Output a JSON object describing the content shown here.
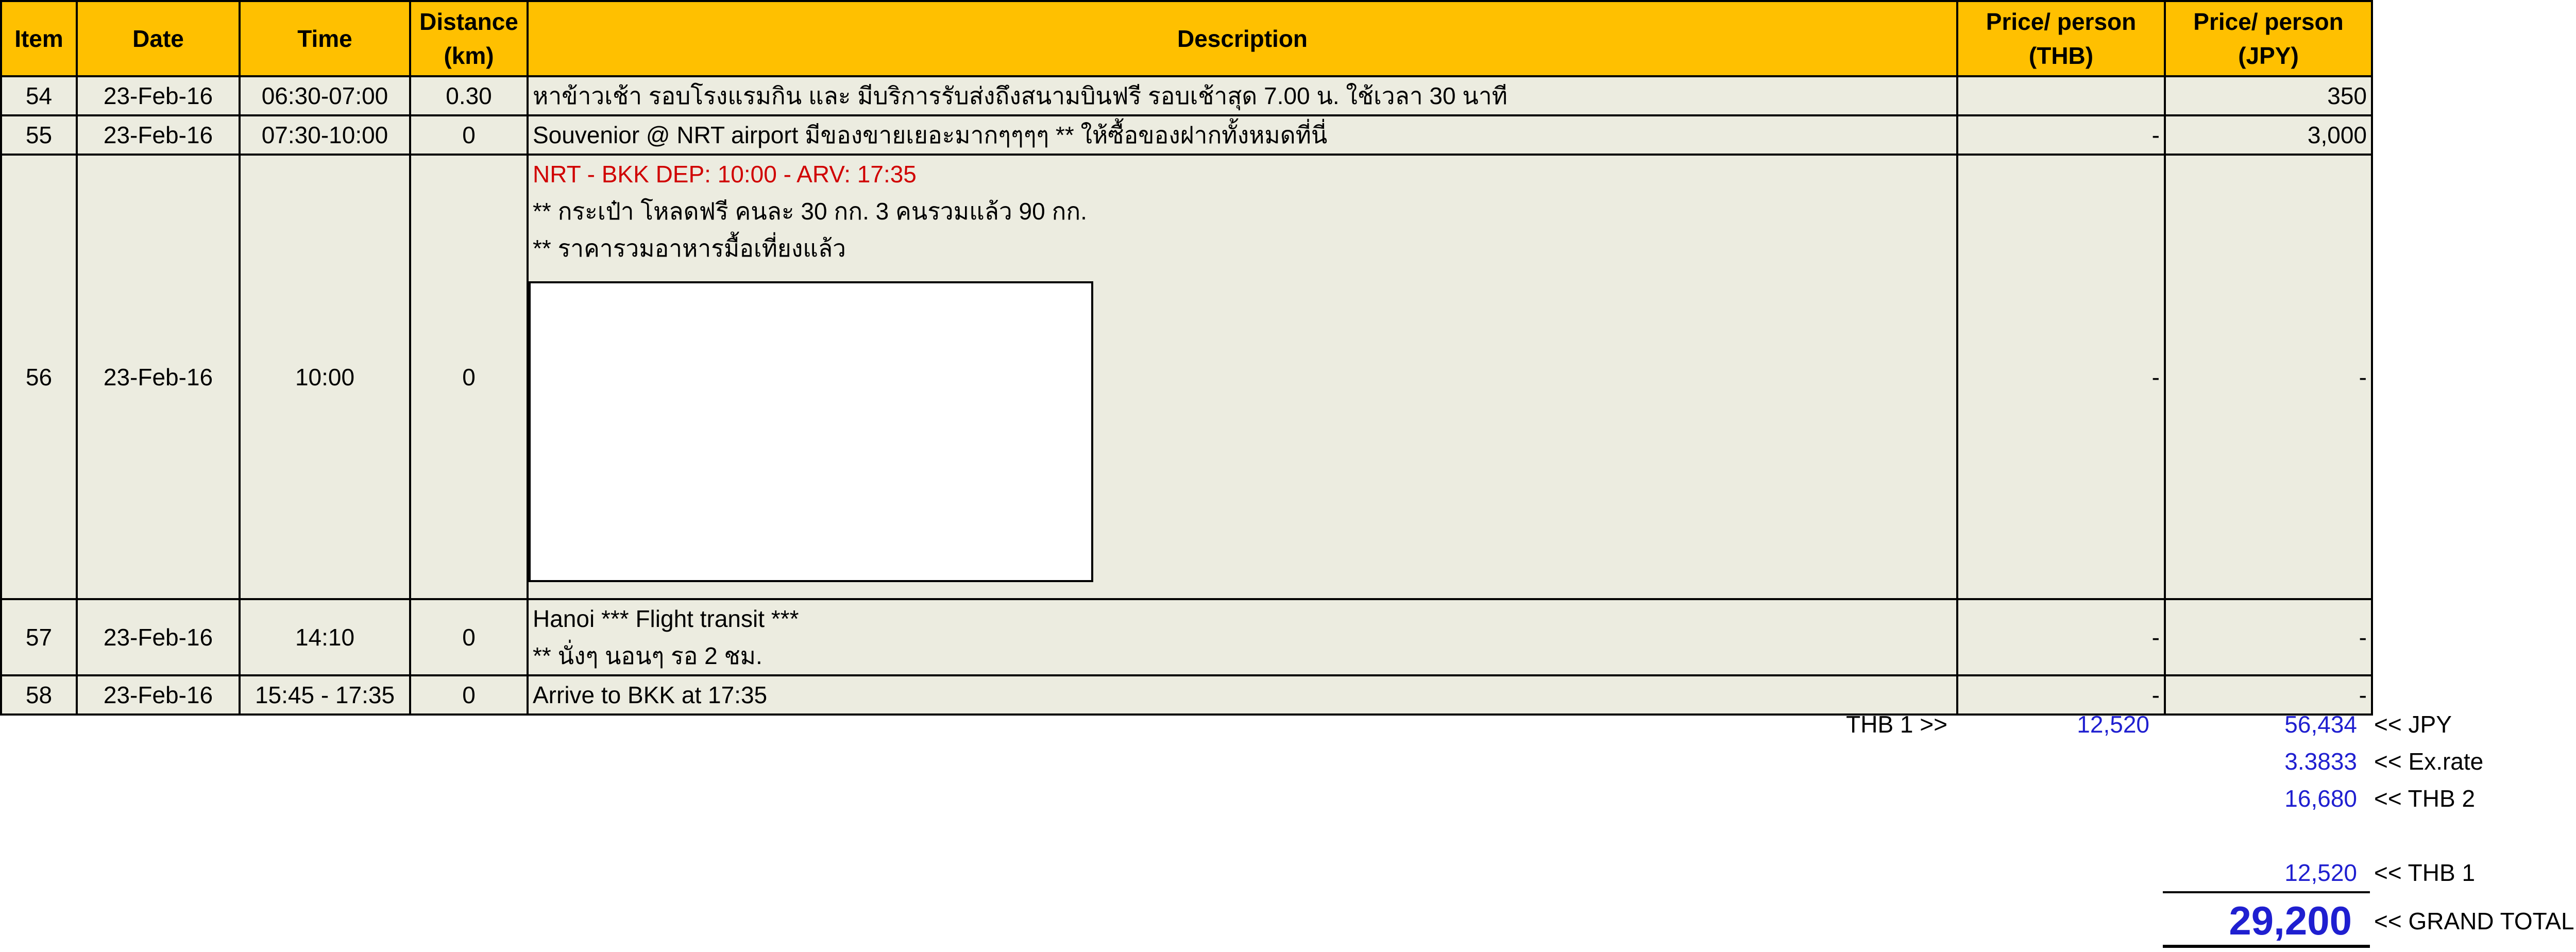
{
  "headers": {
    "item": "Item",
    "date": "Date",
    "time": "Time",
    "distance_l1": "Distance",
    "distance_l2": "(km)",
    "description": "Description",
    "price_thb_l1": "Price/ person",
    "price_thb_l2": "(THB)",
    "price_jpy_l1": "Price/ person",
    "price_jpy_l2": "(JPY)"
  },
  "rows": [
    {
      "item": "54",
      "date": "23-Feb-16",
      "time": "06:30-07:00",
      "distance": "0.30",
      "desc": [
        "หาข้าวเช้า   รอบโรงแรมกิน   และ   มีบริการรับส่งถึงสนามบินฟรี   รอบเช้าสุด   7.00 น. ใช้เวลา   30 นาที"
      ],
      "thb": "",
      "jpy": "350"
    },
    {
      "item": "55",
      "date": "23-Feb-16",
      "time": "07:30-10:00",
      "distance": "0",
      "desc": [
        "Souvenior @ NRT airport มีของขายเยอะมากๆๆๆๆ   ** ให้ซื้อของฝากทั้งหมดที่นี่"
      ],
      "thb": "-",
      "jpy": "3,000"
    },
    {
      "item": "56",
      "date": "23-Feb-16",
      "time": "10:00",
      "distance": "0",
      "desc": [
        "NRT - BKK  DEP: 10:00 - ARV: 17:35",
        "** กระเป๋า   โหลดฟรี   คนละ   30 กก. 3 คนรวมแล้ว   90 กก.",
        "** ราคารวมอาหารมื้อเที่ยงแล้ว"
      ],
      "thb": "-",
      "jpy": "-"
    },
    {
      "item": "57",
      "date": "23-Feb-16",
      "time": "14:10",
      "distance": "0",
      "desc": [
        "Hanoi *** Flight transit ***",
        "** นั่งๆ   นอนๆ   รอ   2 ชม."
      ],
      "thb": "-",
      "jpy": "-"
    },
    {
      "item": "58",
      "date": "23-Feb-16",
      "time": "15:45 - 17:35",
      "distance": "0",
      "desc": [
        "Arrive to BKK at 17:35"
      ],
      "thb": "-",
      "jpy": "-"
    }
  ],
  "summary": {
    "thb1_label": "THB 1 >>",
    "thb1_value": "12,520",
    "jpy_total": "56,434",
    "jpy_label": "<< JPY",
    "exrate_value": "3.3833",
    "exrate_label": "<< Ex.rate",
    "thb2_value": "16,680",
    "thb2_label": "<< THB 2",
    "thb1_repeat_value": "12,520",
    "thb1_repeat_label": "<< THB 1",
    "grand_total_value": "29,200",
    "grand_total_label": "<< GRAND TOTAL"
  },
  "colors": {
    "header_bg": "#FFC000",
    "row_bg": "#ECECE0",
    "accent_blue": "#1F1FD0",
    "flight_red": "#D00000"
  }
}
